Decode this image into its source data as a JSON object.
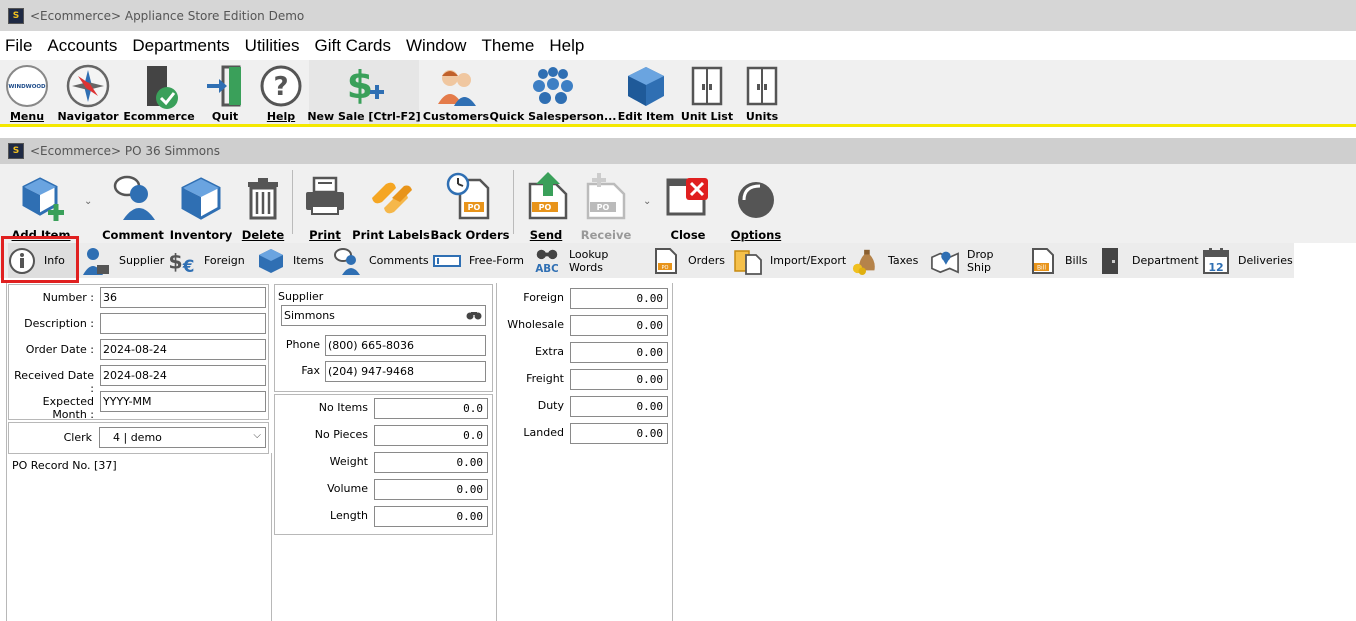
{
  "app": {
    "title": "<Ecommerce> Appliance Store Edition Demo",
    "icon_text": "S"
  },
  "menu": [
    "File",
    "Accounts",
    "Departments",
    "Utilities",
    "Gift Cards",
    "Window",
    "Theme",
    "Help"
  ],
  "main_toolbar": {
    "menu": "Menu",
    "navigator": "Navigator",
    "ecommerce": "Ecommerce",
    "quit": "Quit",
    "help": "Help",
    "new_sale": "New Sale [Ctrl-F2]",
    "customers": "Customers",
    "quick_salesperson": "Quick Salesperson...",
    "edit_item": "Edit Item",
    "unit_list": "Unit List",
    "units": "Units",
    "logo_text": "WINDWOOD"
  },
  "child_window": {
    "title": "<Ecommerce> PO 36 Simmons"
  },
  "record_toolbar": {
    "add_item": "Add Item",
    "comment": "Comment",
    "inventory": "Inventory",
    "delete": "Delete",
    "print": "Print",
    "print_labels": "Print Labels",
    "back_orders": "Back Orders",
    "send": "Send",
    "receive": "Receive",
    "close": "Close",
    "options": "Options",
    "po_badge": "PO"
  },
  "tabs": [
    {
      "label": "Info"
    },
    {
      "label": "Supplier"
    },
    {
      "label": "Foreign"
    },
    {
      "label": "Items"
    },
    {
      "label": "Comments"
    },
    {
      "label": "Free-Form"
    },
    {
      "label": "Lookup Words"
    },
    {
      "label": "Orders"
    },
    {
      "label": "Import/Export"
    },
    {
      "label": "Taxes"
    },
    {
      "label": "Drop Ship"
    },
    {
      "label": "Bills"
    },
    {
      "label": "Department"
    },
    {
      "label": "Deliveries"
    }
  ],
  "tab_icon_text": {
    "abc": "ABC",
    "bill": "Bill",
    "po": "PO",
    "cal": "12"
  },
  "info": {
    "number_label": "Number :",
    "number": "36",
    "description_label": "Description :",
    "description": "",
    "order_date_label": "Order Date :",
    "order_date": "2024-08-24",
    "received_date_label": "Received Date :",
    "received_date": "2024-08-24",
    "expected_month_label": "Expected Month :",
    "expected_month": "YYYY-MM",
    "clerk_label": "Clerk",
    "clerk": "4 | demo",
    "record_no": "PO Record No. [37]"
  },
  "supplier": {
    "label": "Supplier",
    "name": "Simmons",
    "phone_label": "Phone",
    "phone": "(800) 665-8036",
    "fax_label": "Fax",
    "fax": "(204) 947-9468"
  },
  "quantities": {
    "no_items_label": "No Items",
    "no_items": "0.0",
    "no_pieces_label": "No Pieces",
    "no_pieces": "0.0",
    "weight_label": "Weight",
    "weight": "0.00",
    "volume_label": "Volume",
    "volume": "0.00",
    "length_label": "Length",
    "length": "0.00"
  },
  "costs": {
    "foreign_label": "Foreign",
    "foreign": "0.00",
    "wholesale_label": "Wholesale",
    "wholesale": "0.00",
    "extra_label": "Extra",
    "extra": "0.00",
    "freight_label": "Freight",
    "freight": "0.00",
    "duty_label": "Duty",
    "duty": "0.00",
    "landed_label": "Landed",
    "landed": "0.00"
  },
  "colors": {
    "accent_yellow": "#f4e800",
    "highlight_red": "#e02020",
    "icon_blue": "#2f6fb3",
    "icon_green": "#3aa05a"
  }
}
